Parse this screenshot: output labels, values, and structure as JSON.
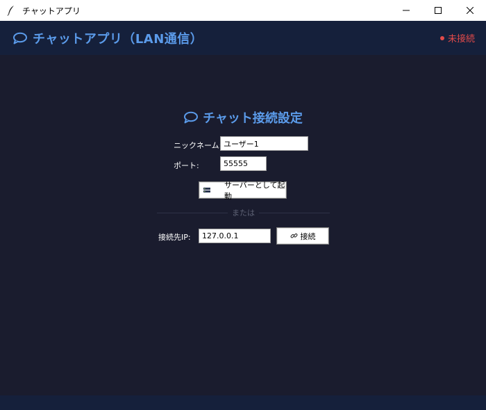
{
  "window": {
    "title": "チャットアプリ"
  },
  "header": {
    "title": "チャットアプリ（LAN通信）",
    "status": "未接続",
    "status_color": "#e24a4a",
    "accent_color": "#5b9bea"
  },
  "setup": {
    "title": "チャット接続設定",
    "nickname_label": "ニックネーム:",
    "nickname_value": "ユーザー1",
    "port_label": "ポート:",
    "port_value": "55555",
    "server_button_label": "サーバーとして起動",
    "divider_text": "または",
    "ip_label": "接続先IP:",
    "ip_value": "127.0.0.1",
    "connect_button_label": "接続"
  },
  "icons": {
    "app": "feather-icon",
    "logo": "speech-bubble-icon",
    "server": "server-icon",
    "connect": "link-icon"
  }
}
